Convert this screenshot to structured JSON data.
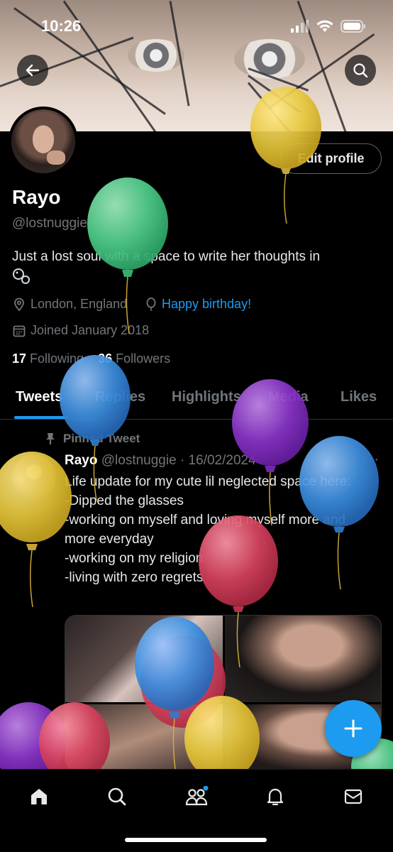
{
  "status_bar": {
    "time": "10:26"
  },
  "header": {
    "back_icon": "arrow-left-icon",
    "search_icon": "search-icon"
  },
  "profile": {
    "edit_button": "Edit profile",
    "name": "Rayo",
    "handle": "@lostnuggie",
    "bio": "Just a lost soul with a space to write her thoughts in",
    "bio_emoji": "bubbles",
    "location": "London, England",
    "birthday": "Happy birthday!",
    "joined": "Joined January 2018",
    "following_count": "17",
    "following_label": "Following",
    "followers_count": "36",
    "followers_label": "Followers"
  },
  "tabs": [
    {
      "label": "Tweets",
      "active": true
    },
    {
      "label": "Replies",
      "active": false
    },
    {
      "label": "Highlights",
      "active": false
    },
    {
      "label": "Media",
      "active": false
    },
    {
      "label": "Likes",
      "active": false
    }
  ],
  "pinned_tweet": {
    "pinned_label": "Pinned Tweet",
    "author_name": "Rayo",
    "author_handle": "@lostnuggie",
    "date": "· 16/02/2024",
    "text": "Life update for my cute lil neglected space here:\n-Dipped the glasses\n-working on myself and loving myself more and more everyday\n-working on my religion\n-living with zero regrets"
  },
  "compose_button": {
    "icon": "plus-icon"
  },
  "bottom_nav": [
    {
      "name": "home",
      "icon": "home-icon",
      "active": true
    },
    {
      "name": "search",
      "icon": "search-icon"
    },
    {
      "name": "communities",
      "icon": "people-icon",
      "badge": true
    },
    {
      "name": "notifications",
      "icon": "bell-icon"
    },
    {
      "name": "messages",
      "icon": "mail-icon"
    }
  ],
  "colors": {
    "accent": "#1d9bf0",
    "muted": "#71767b",
    "background": "#000000",
    "balloon_yellow": "#e6c63a",
    "balloon_green": "#4fcf8a",
    "balloon_blue": "#3d8fe0",
    "balloon_purple": "#8a35c9",
    "balloon_red": "#d8435f"
  }
}
